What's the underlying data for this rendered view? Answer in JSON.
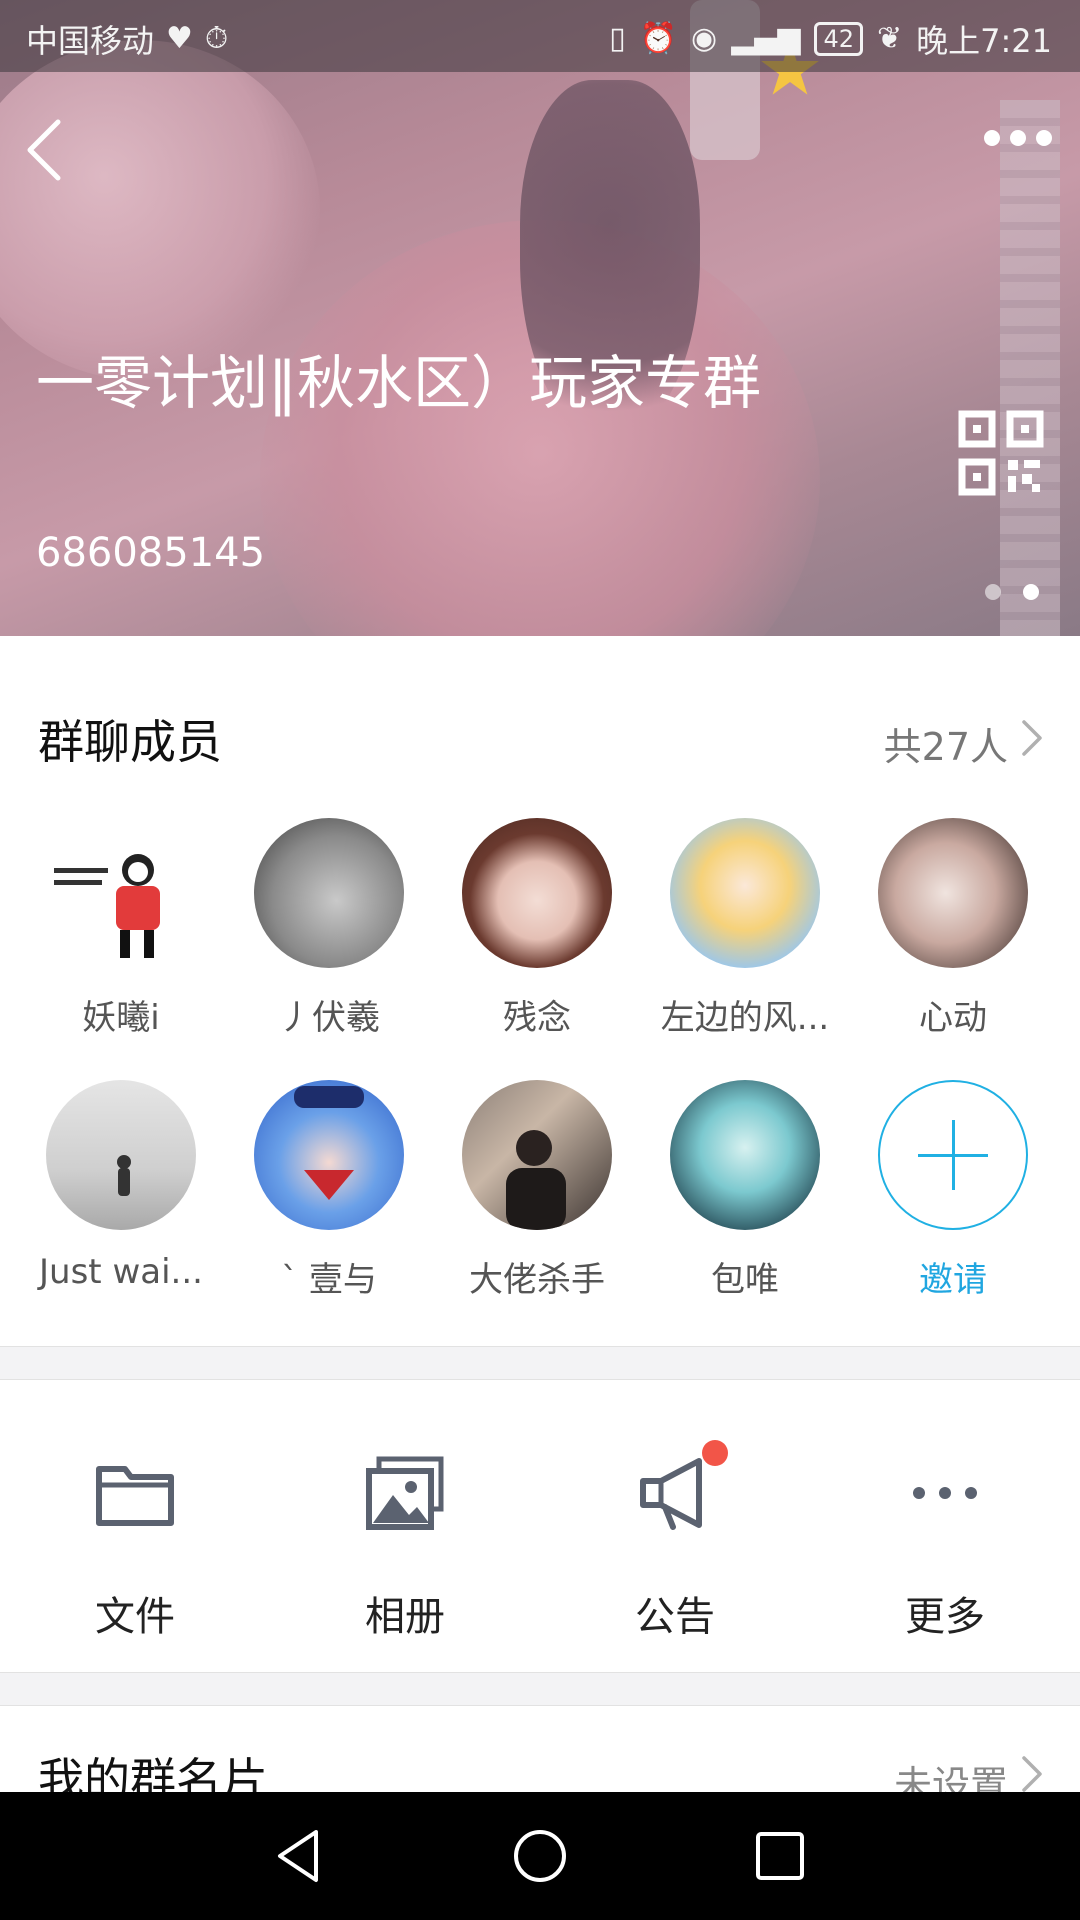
{
  "status_bar": {
    "carrier": "中国移动",
    "battery": "42",
    "time": "晚上7:21",
    "icons": [
      "heart-rate-icon",
      "stopwatch-icon",
      "vibrate-icon",
      "alarm-icon",
      "eye-icon",
      "4g-signal-icon",
      "battery-icon",
      "leaf-icon"
    ]
  },
  "header": {
    "group_name": "一零计划‖秋水区）玩家专群",
    "group_id": "686085145",
    "page_count": 2,
    "active_page": 2
  },
  "members": {
    "title": "群聊成员",
    "count_label": "共27人",
    "list": [
      {
        "name": "妖曦i"
      },
      {
        "name": "丿伏羲"
      },
      {
        "name": "残念"
      },
      {
        "name": "左边的风..."
      },
      {
        "name": "心动"
      },
      {
        "name": "Just wai..."
      },
      {
        "name": "`  壹与"
      },
      {
        "name": "大佬杀手"
      },
      {
        "name": "包唯"
      }
    ],
    "invite_label": "邀请"
  },
  "tools": [
    {
      "label": "文件",
      "icon": "folder-icon"
    },
    {
      "label": "相册",
      "icon": "album-icon"
    },
    {
      "label": "公告",
      "icon": "megaphone-icon"
    },
    {
      "label": "更多",
      "icon": "more-icon"
    }
  ],
  "my_card": {
    "title": "我的群名片",
    "value": "未设置"
  },
  "colors": {
    "accent": "#20b0e3",
    "badge": "#f25548"
  }
}
